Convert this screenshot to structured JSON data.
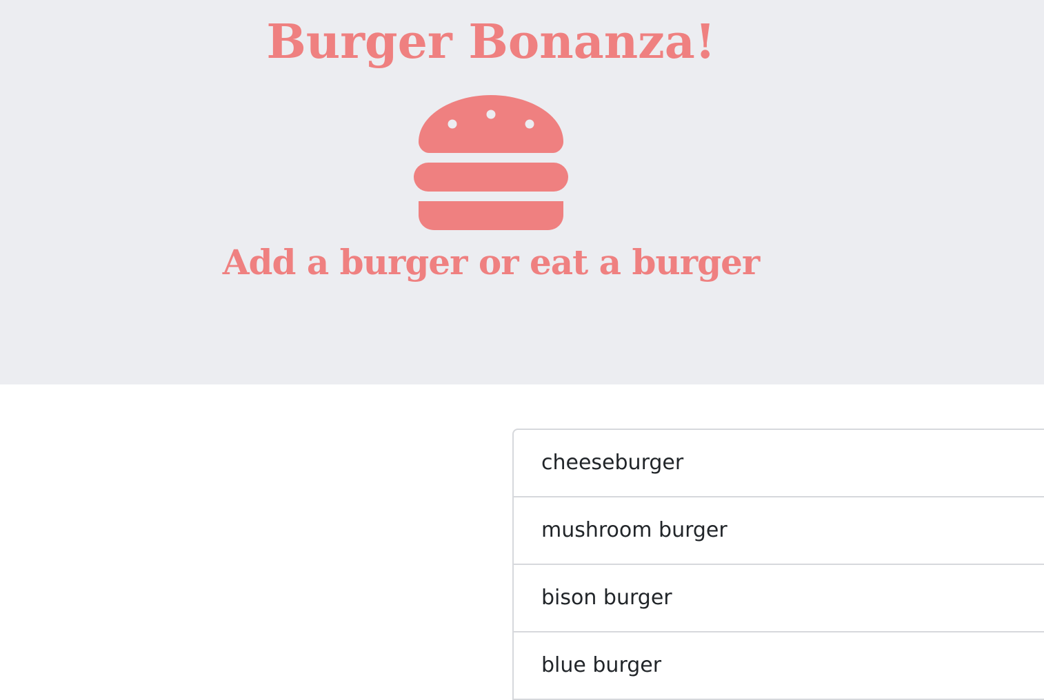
{
  "header": {
    "title": "Burger Bonanza!",
    "subtitle": "Add a burger or eat a burger",
    "icon": "hamburger-icon",
    "accent_color": "#ef8080",
    "background_color": "#ecedf1"
  },
  "burgers": [
    {
      "name": "cheeseburger"
    },
    {
      "name": "mushroom burger"
    },
    {
      "name": "bison burger"
    },
    {
      "name": "blue burger"
    }
  ]
}
